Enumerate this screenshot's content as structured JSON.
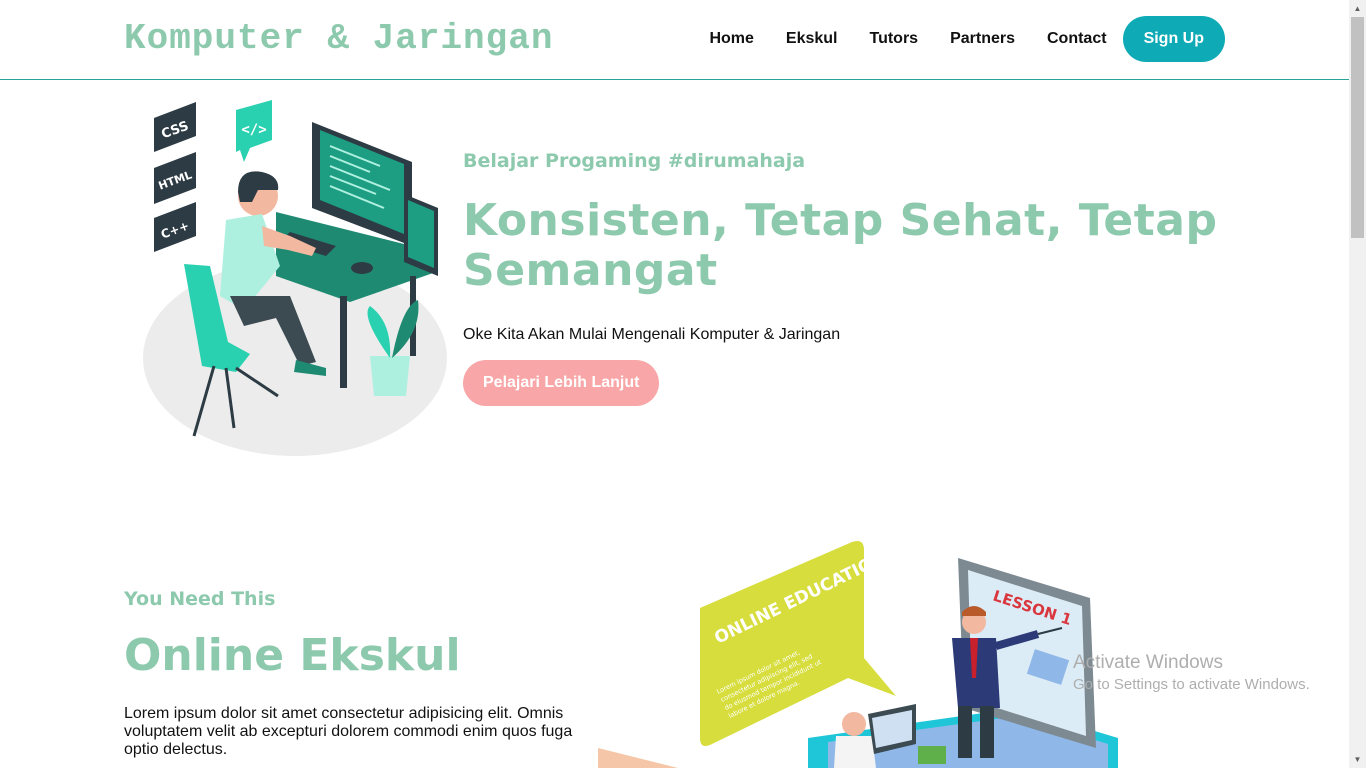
{
  "header": {
    "brand": "Komputer & Jaringan",
    "nav": [
      "Home",
      "Ekskul",
      "Tutors",
      "Partners",
      "Contact"
    ],
    "signup": "Sign Up"
  },
  "hero": {
    "eyebrow": "Belajar Progaming #dirumahaja",
    "title": "Konsisten, Tetap Sehat, Tetap Semangat",
    "description": "Oke Kita Akan Mulai Mengenali Komputer & Jaringan",
    "cta": "Pelajari Lebih Lanjut",
    "illustration_badges": [
      "CSS",
      "HTML",
      "C++"
    ]
  },
  "ekskul": {
    "eyebrow": "You Need This",
    "title": "Online Ekskul",
    "body": "Lorem ipsum dolor sit amet consectetur adipisicing elit. Omnis voluptatem velit ab excepturi dolorem commodi enim quos fuga optio delectus.",
    "bubble_title": "ONLINE EDUCATION",
    "bubble_text": "Lorem ipsum dolor sit amet, consectetur adipiscing elit, sed do eiusmod tempor incididunt ut labore et dolore magna.",
    "screen_label": "LESSON 1"
  },
  "watermark": {
    "title": "Activate Windows",
    "subtitle": "Go to Settings to activate Windows."
  },
  "colors": {
    "accent_green": "#8cc9ad",
    "teal_button": "#0eaab5",
    "pink_button": "#f8a6a7",
    "header_border": "#2aa39b"
  }
}
